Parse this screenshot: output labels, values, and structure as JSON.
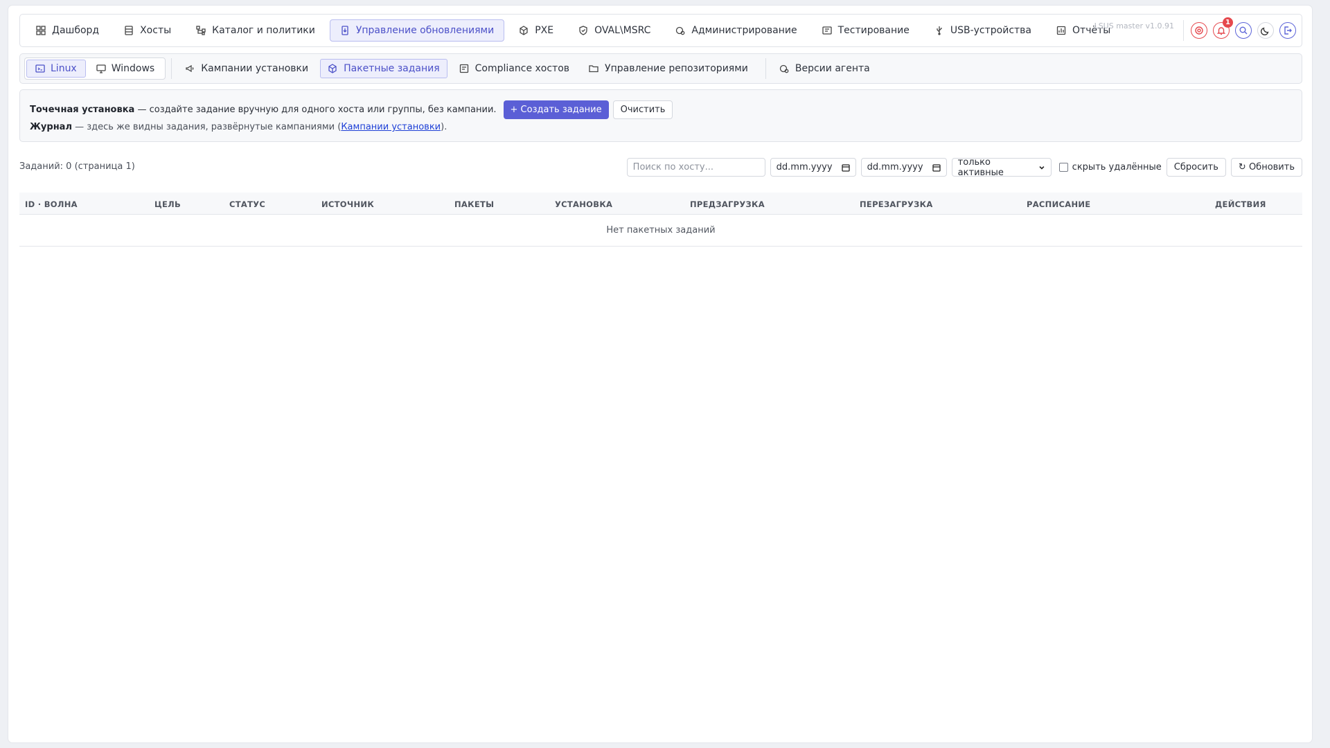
{
  "topnav": {
    "items": [
      {
        "label": "Дашборд",
        "icon": "dashboard-icon"
      },
      {
        "label": "Хосты",
        "icon": "server-icon"
      },
      {
        "label": "Каталог и политики",
        "icon": "hierarchy-icon"
      },
      {
        "label": "Управление обновлениями",
        "icon": "update-icon",
        "active": true
      },
      {
        "label": "PXE",
        "icon": "cube-icon"
      },
      {
        "label": "OVAL\\MSRC",
        "icon": "shield-icon"
      },
      {
        "label": "Администрирование",
        "icon": "admin-gear-icon"
      },
      {
        "label": "Тестирование",
        "icon": "test-icon"
      },
      {
        "label": "USB-устройства",
        "icon": "usb-icon"
      },
      {
        "label": "Отчёты",
        "icon": "report-icon"
      }
    ],
    "version": "LSUS master v1.0.91",
    "notifications_count": "1"
  },
  "subnav": {
    "os": [
      {
        "label": "Linux",
        "active": true
      },
      {
        "label": "Windows"
      }
    ],
    "items": [
      {
        "label": "Кампании установки",
        "icon": "megaphone-icon"
      },
      {
        "label": "Пакетные задания",
        "icon": "package-icon",
        "active": true
      },
      {
        "label": "Compliance хостов",
        "icon": "list-check-icon"
      },
      {
        "label": "Управление репозиториями",
        "icon": "folder-icon"
      }
    ],
    "agent_versions": {
      "label": "Версии агента",
      "icon": "agent-icon"
    }
  },
  "info": {
    "line1_bold": "Точечная установка",
    "line1_text": " — создайте задание вручную для одного хоста или группы, без кампании.",
    "create_button": "+ Создать задание",
    "clear_button": "Очистить",
    "line2_bold": "Журнал",
    "line2_text": " — здесь же видны задания, развёрнутые кампаниями (",
    "line2_link": "Кампании установки",
    "line2_end": ")."
  },
  "toolbar": {
    "count": "Заданий: 0 (страница 1)",
    "search_placeholder": "Поиск по хосту...",
    "date_from": "dd.mm.yyyy",
    "date_to": "dd.mm.yyyy",
    "status_filter": "только активные",
    "hide_deleted": "скрыть удалённые",
    "reset_button": "Сбросить",
    "refresh_button": "↻ Обновить"
  },
  "table": {
    "columns": [
      "ID · ВОЛНА",
      "ЦЕЛЬ",
      "СТАТУС",
      "ИСТОЧНИК",
      "ПАКЕТЫ",
      "УСТАНОВКА",
      "ПРЕДЗАГРУЗКА",
      "ПЕРЕЗАГРУЗКА",
      "РАСПИСАНИЕ",
      "ДЕЙСТВИЯ"
    ],
    "empty_text": "Нет пакетных заданий"
  },
  "colors": {
    "accent": "#5b5fd6",
    "active_bg": "#edeefc",
    "danger": "#e5484d",
    "link": "#1d3fd6"
  }
}
